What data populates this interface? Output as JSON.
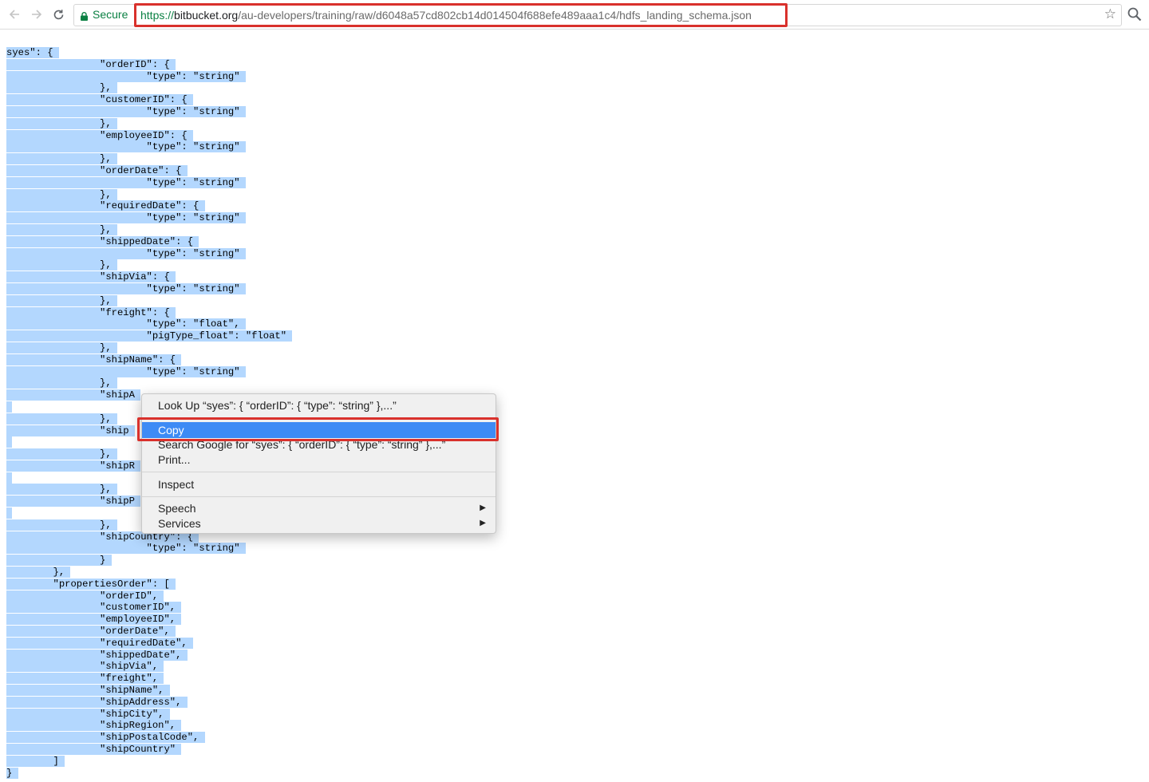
{
  "toolbar": {
    "secure_label": "Secure",
    "url_scheme": "https://",
    "url_host": "bitbucket.org",
    "url_path": "/au-developers/training/raw/d6048a57cd802cb14d014504f688efe489aaa1c4/hdfs_landing_schema.json",
    "highlight_color": "#d9312c"
  },
  "document": {
    "lines": [
      "syes\": {",
      "                \"orderID\": {",
      "                        \"type\": \"string\"",
      "                },",
      "                \"customerID\": {",
      "                        \"type\": \"string\"",
      "                },",
      "                \"employeeID\": {",
      "                        \"type\": \"string\"",
      "                },",
      "                \"orderDate\": {",
      "                        \"type\": \"string\"",
      "                },",
      "                \"requiredDate\": {",
      "                        \"type\": \"string\"",
      "                },",
      "                \"shippedDate\": {",
      "                        \"type\": \"string\"",
      "                },",
      "                \"shipVia\": {",
      "                        \"type\": \"string\"",
      "                },",
      "                \"freight\": {",
      "                        \"type\": \"float\",",
      "                        \"pigType_float\": \"float\"",
      "                },",
      "                \"shipName\": {",
      "                        \"type\": \"string\"",
      "                },",
      "                \"shipA",
      "",
      "                },",
      "                \"ship",
      "",
      "                },",
      "                \"shipR",
      "",
      "                },",
      "                \"shipP",
      "",
      "                },",
      "                \"shipCountry\": {",
      "                        \"type\": \"string\"",
      "                }",
      "        },",
      "        \"propertiesOrder\": [",
      "                \"orderID\",",
      "                \"customerID\",",
      "                \"employeeID\",",
      "                \"orderDate\",",
      "                \"requiredDate\",",
      "                \"shippedDate\",",
      "                \"shipVia\",",
      "                \"freight\",",
      "                \"shipName\",",
      "                \"shipAddress\",",
      "                \"shipCity\",",
      "                \"shipRegion\",",
      "                \"shipPostalCode\",",
      "                \"shipCountry\"",
      "        ]",
      "}"
    ],
    "selection_color": "#b3d7fe"
  },
  "context_menu": {
    "look_up": "Look Up “syes”: {   “orderID”: {    “type”: “string”   },...”",
    "copy": "Copy",
    "search_google": "Search Google for “syes”: {   “orderID”: {    “type”: “string”   },...”",
    "print": "Print...",
    "inspect": "Inspect",
    "speech": "Speech",
    "services": "Services",
    "highlight_color": "#3d8bf5"
  }
}
